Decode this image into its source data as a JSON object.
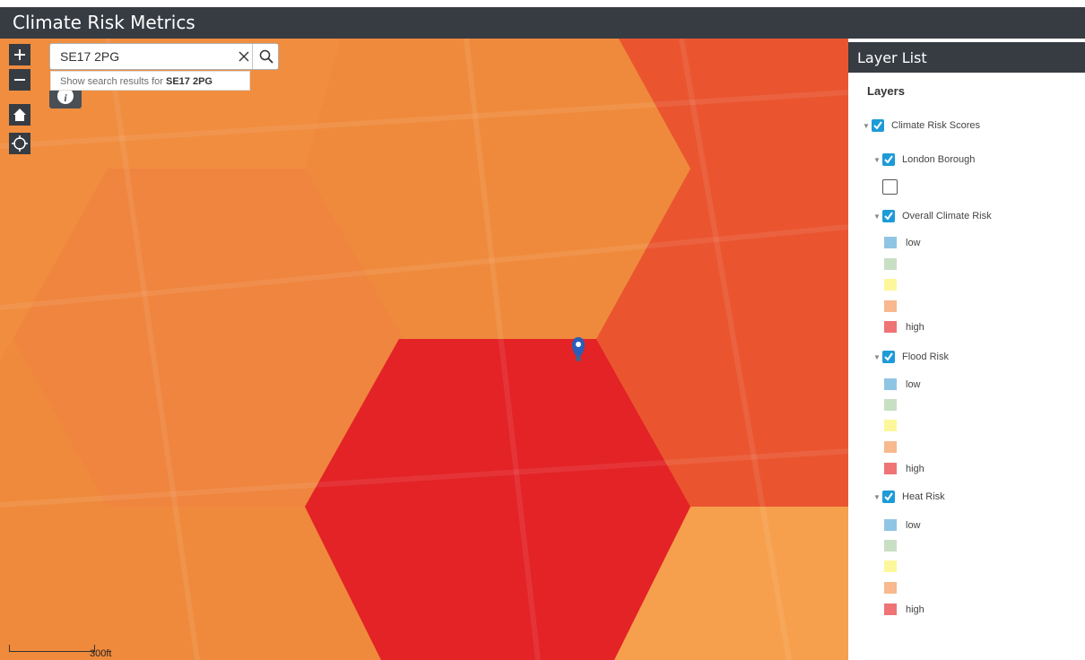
{
  "app": {
    "title": "Climate Risk Metrics"
  },
  "map": {
    "search": {
      "value": "SE17 2PG",
      "suggestion_prefix": "Show search results for ",
      "suggestion_query": "SE17 2PG"
    },
    "scale_label": "300ft",
    "controls": {
      "zoom_in": "+",
      "zoom_out": "−",
      "info": "i"
    },
    "fill_colors": {
      "background": "#ef8a3c",
      "high": "#e32326",
      "mid_high": "#ea5530",
      "light": "#f6a04d"
    }
  },
  "layer_list": {
    "title": "Layer List",
    "heading": "Layers",
    "root": {
      "label": "Climate Risk Scores",
      "checked": true
    },
    "groups": [
      {
        "label": "London Borough",
        "checked": true,
        "legend": [
          {
            "label": "",
            "color": "#ffffff",
            "outline": true
          }
        ]
      },
      {
        "label": "Overall Climate Risk",
        "checked": true,
        "legend": [
          {
            "label": "low",
            "color": "#8fc5e3"
          },
          {
            "label": "",
            "color": "#c9dfc3"
          },
          {
            "label": "",
            "color": "#fdf79b"
          },
          {
            "label": "",
            "color": "#f7b98d"
          },
          {
            "label": "high",
            "color": "#ee7476"
          }
        ]
      },
      {
        "label": "Flood Risk",
        "checked": true,
        "legend": [
          {
            "label": "low",
            "color": "#8fc5e3"
          },
          {
            "label": "",
            "color": "#c9dfc3"
          },
          {
            "label": "",
            "color": "#fdf79b"
          },
          {
            "label": "",
            "color": "#f7b98d"
          },
          {
            "label": "high",
            "color": "#ee7476"
          }
        ]
      },
      {
        "label": "Heat Risk",
        "checked": true,
        "legend": [
          {
            "label": "low",
            "color": "#8fc5e3"
          },
          {
            "label": "",
            "color": "#c9dfc3"
          },
          {
            "label": "",
            "color": "#fdf79b"
          },
          {
            "label": "",
            "color": "#f7b98d"
          },
          {
            "label": "high",
            "color": "#ee7476"
          }
        ]
      }
    ]
  },
  "icons": [
    "plus-icon",
    "minus-icon",
    "home-icon",
    "locate-icon",
    "search-icon",
    "close-icon",
    "info-icon",
    "map-pin-icon",
    "checkmark-icon",
    "caret-down-icon"
  ]
}
